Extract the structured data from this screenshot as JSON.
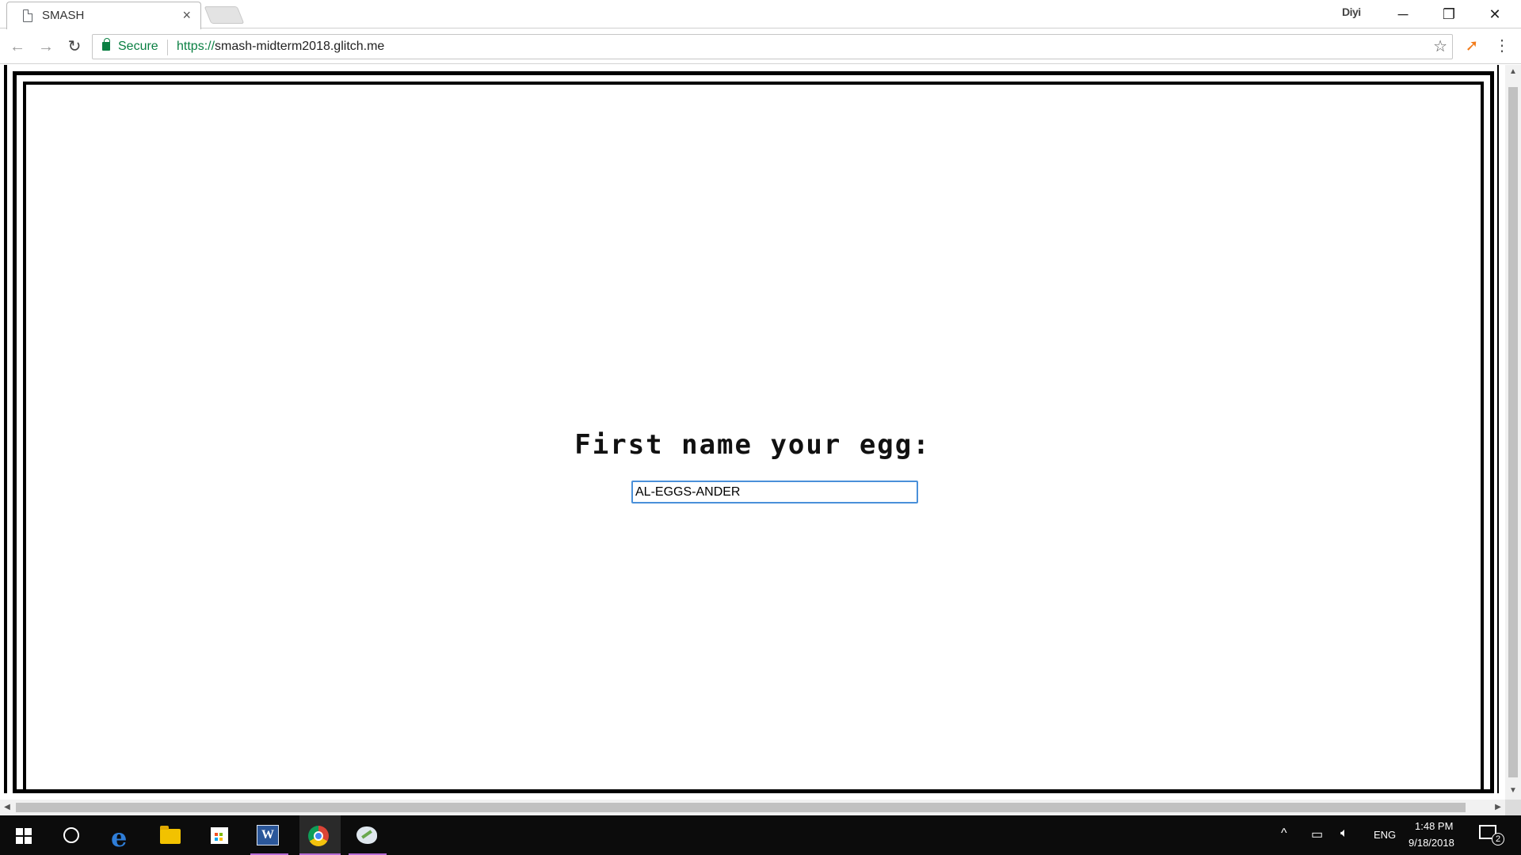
{
  "browser": {
    "tab_title": "SMASH",
    "tab_close": "×",
    "profile_label": "Diyi",
    "window_controls": {
      "minimize": "─",
      "restore": "❐",
      "close": "✕"
    },
    "nav": {
      "back": "←",
      "forward": "→",
      "reload": "↻"
    },
    "security_label": "Secure",
    "url_scheme": "https://",
    "url_host": "smash-midterm2018.glitch.me",
    "bookmark_star": "☆",
    "menu": "⋮"
  },
  "page": {
    "prompt": "First name your egg:",
    "name_value": "AL-EGGS-ANDER"
  },
  "scroll": {
    "up": "▲",
    "down": "▼",
    "left": "◀",
    "right": "▶"
  },
  "taskbar": {
    "tray_chevron": "^",
    "language": "ENG",
    "time": "1:48 PM",
    "date": "9/18/2018",
    "notification_count": "2"
  },
  "colors": {
    "secure_green": "#0b8043",
    "focus_blue": "#4a90d9",
    "taskbar_bg": "#0c0c0c",
    "active_app_underline": "#b66cd6"
  }
}
